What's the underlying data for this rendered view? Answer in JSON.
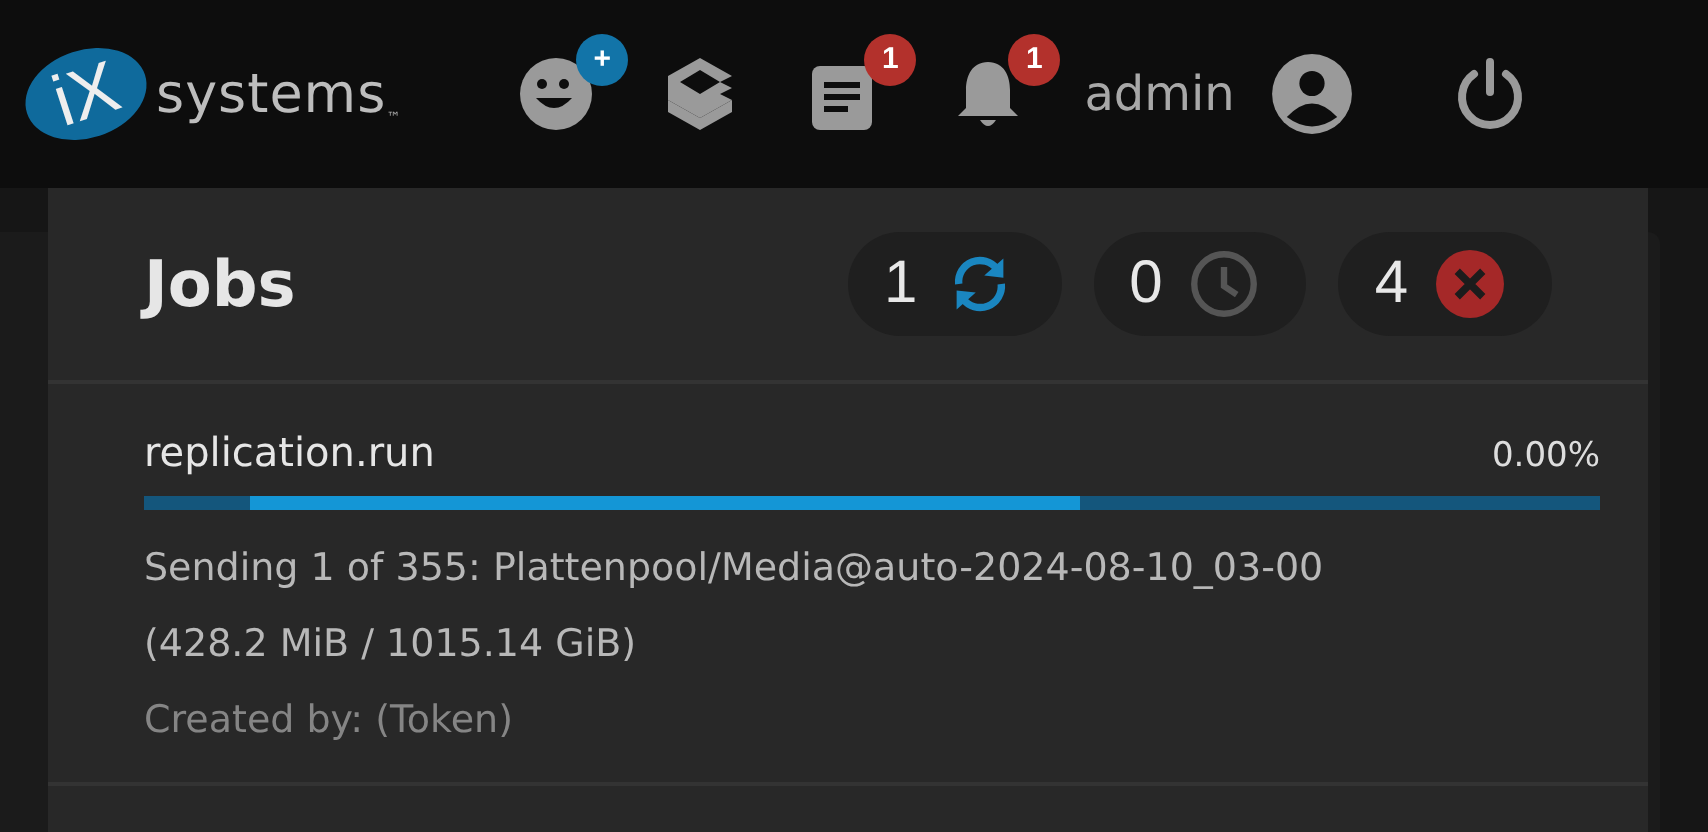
{
  "logo": {
    "mark": "iX",
    "name": "systems",
    "trademark": "™"
  },
  "toolbar": [
    {
      "kind": "feedback",
      "badge": "+"
    },
    {
      "kind": "apps"
    },
    {
      "kind": "tasks",
      "badge": "1"
    },
    {
      "kind": "alerts",
      "badge": "1"
    }
  ],
  "user": {
    "name": "admin"
  },
  "jobs_panel": {
    "title": "Jobs",
    "counters": [
      {
        "kind": "running",
        "count": "1"
      },
      {
        "kind": "waiting",
        "count": "0"
      },
      {
        "kind": "failed",
        "count": "4"
      }
    ],
    "jobs": [
      {
        "name": "replication.run",
        "reading": "0.00%",
        "indeterminate": true,
        "description": "Sending 1 of 355: Plattenpool/Media@auto-2024-08-10_03-00 (428.2 MiB / 1015.14 GiB)",
        "created_by": "Created by: (Token)"
      }
    ]
  }
}
